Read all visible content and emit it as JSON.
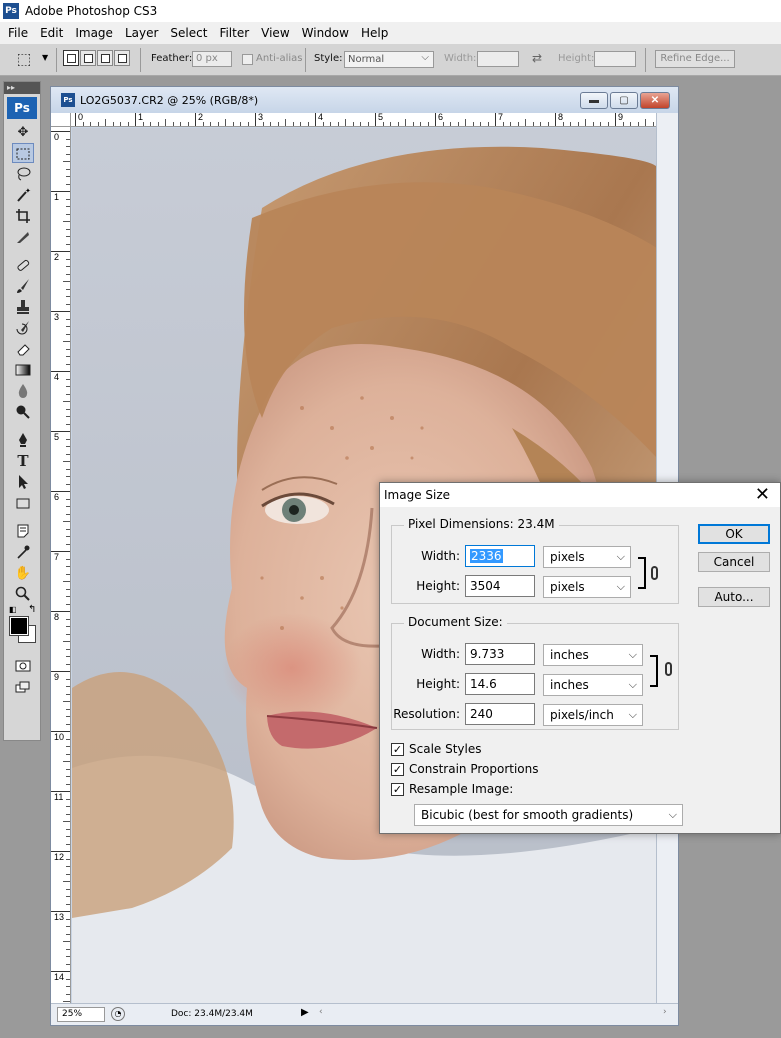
{
  "app": {
    "title": "Adobe Photoshop CS3",
    "logo": "Ps"
  },
  "menu": [
    "File",
    "Edit",
    "Image",
    "Layer",
    "Select",
    "Filter",
    "View",
    "Window",
    "Help"
  ],
  "options": {
    "feather_label": "Feather:",
    "feather_value": "0 px",
    "antialias_label": "Anti-alias",
    "style_label": "Style:",
    "style_value": "Normal",
    "width_label": "Width:",
    "height_label": "Height:",
    "refine_edge": "Refine Edge..."
  },
  "tools": {
    "logo": "Ps",
    "items": [
      "move-tool",
      "marquee-tool",
      "lasso-tool",
      "magic-wand-tool",
      "crop-tool",
      "slice-tool",
      "healing-brush-tool",
      "brush-tool",
      "clone-stamp-tool",
      "history-brush-tool",
      "eraser-tool",
      "gradient-tool",
      "blur-tool",
      "dodge-tool",
      "pen-tool",
      "type-tool",
      "path-selection-tool",
      "shape-tool",
      "notes-tool",
      "eyedropper-tool",
      "hand-tool",
      "zoom-tool"
    ],
    "foreground": "#000000",
    "background": "#ffffff"
  },
  "document": {
    "title": "LO2G5037.CR2 @ 25% (RGB/8*)",
    "zoom": "25%",
    "doc_info": "Doc: 23.4M/23.4M",
    "ruler_h": [
      "0",
      "1",
      "2",
      "3",
      "4",
      "5",
      "6",
      "7",
      "8",
      "9"
    ],
    "ruler_v": [
      "0",
      "1",
      "2",
      "3",
      "4",
      "5",
      "6",
      "7",
      "8",
      "9",
      "10",
      "11",
      "12",
      "13",
      "14"
    ],
    "canvas_bg": "#c2c8d2"
  },
  "dialog": {
    "title": "Image Size",
    "pixel_dimensions_label": "Pixel Dimensions:",
    "pixel_dimensions_value": "23.4M",
    "pixel_width_label": "Width:",
    "pixel_width_value": "2336",
    "pixel_width_unit": "pixels",
    "pixel_height_label": "Height:",
    "pixel_height_value": "3504",
    "pixel_height_unit": "pixels",
    "document_size_label": "Document Size:",
    "doc_width_label": "Width:",
    "doc_width_value": "9.733",
    "doc_width_unit": "inches",
    "doc_height_label": "Height:",
    "doc_height_value": "14.6",
    "doc_height_unit": "inches",
    "resolution_label": "Resolution:",
    "resolution_value": "240",
    "resolution_unit": "pixels/inch",
    "scale_styles": "Scale Styles",
    "constrain_proportions": "Constrain Proportions",
    "resample_image": "Resample Image:",
    "resample_method": "Bicubic (best for smooth gradients)",
    "ok": "OK",
    "cancel": "Cancel",
    "auto": "Auto..."
  }
}
